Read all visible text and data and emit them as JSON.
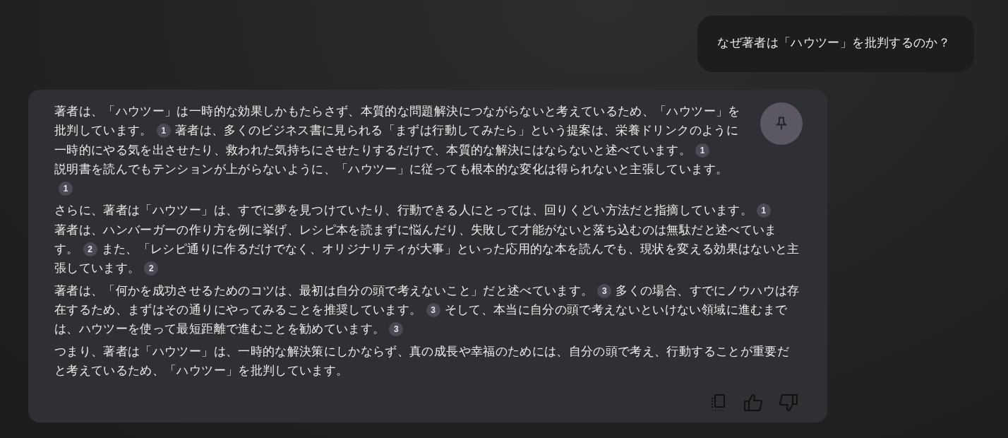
{
  "user_message": {
    "text": "なぜ著者は「ハウツー」を批判するのか？"
  },
  "answer": {
    "paragraphs": [
      {
        "segments": [
          {
            "kind": "text",
            "text": "著者は、「ハウツー」は一時的な効果しかもたらさず、本質的な問題解決につながらないと考えているため、「ハウツー」を批判しています。"
          },
          {
            "kind": "citation",
            "text": "1"
          },
          {
            "kind": "text",
            "text": "著者は、多くのビジネス書に見られる「まずは行動してみたら」という提案は、栄養ドリンクのように一時的にやる気を出させたり、救われた気持ちにさせたりするだけで、本質的な解決にはならないと述べています。"
          },
          {
            "kind": "citation",
            "text": "1"
          },
          {
            "kind": "break"
          },
          {
            "kind": "text",
            "text": "説明書を読んでもテンションが上がらないように、「ハウツー」に従っても根本的な変化は得られないと主張しています。"
          },
          {
            "kind": "citation",
            "text": "1"
          }
        ]
      },
      {
        "segments": [
          {
            "kind": "text",
            "text": "さらに、著者は「ハウツー」は、すでに夢を見つけていたり、行動できる人にとっては、回りくどい方法だと指摘しています。"
          },
          {
            "kind": "citation",
            "text": "1"
          },
          {
            "kind": "break"
          },
          {
            "kind": "text",
            "text": "著者は、ハンバーガーの作り方を例に挙げ、レシピ本を読まずに悩んだり、失敗して才能がないと落ち込むのは無駄だと述べています。"
          },
          {
            "kind": "citation",
            "text": "2"
          },
          {
            "kind": "text",
            "text": "また、「レシピ通りに作るだけでなく、オリジナリティが大事」といった応用的な本を読んでも、現状を変える効果はないと主張しています。"
          },
          {
            "kind": "citation",
            "text": "2"
          }
        ]
      },
      {
        "segments": [
          {
            "kind": "text",
            "text": "著者は、「何かを成功させるためのコツは、最初は自分の頭で考えないこと」だと述べています。"
          },
          {
            "kind": "citation",
            "text": "3"
          },
          {
            "kind": "text",
            "text": "多くの場合、すでにノウハウは存在するため、まずはその通りにやってみることを推奨しています。"
          },
          {
            "kind": "citation",
            "text": "3"
          },
          {
            "kind": "text",
            "text": "そして、本当に自分の頭で考えないといけない領域に進むまでは、ハウツーを使って最短距離で進むことを勧めています。"
          },
          {
            "kind": "citation",
            "text": "3"
          }
        ]
      },
      {
        "segments": [
          {
            "kind": "text",
            "text": "つまり、著者は「ハウツー」は、一時的な解決策にしかならず、真の成長や幸福のためには、自分の頭で考え、行動することが重要だと考えているため、「ハウツー」を批判しています。"
          }
        ]
      }
    ]
  }
}
